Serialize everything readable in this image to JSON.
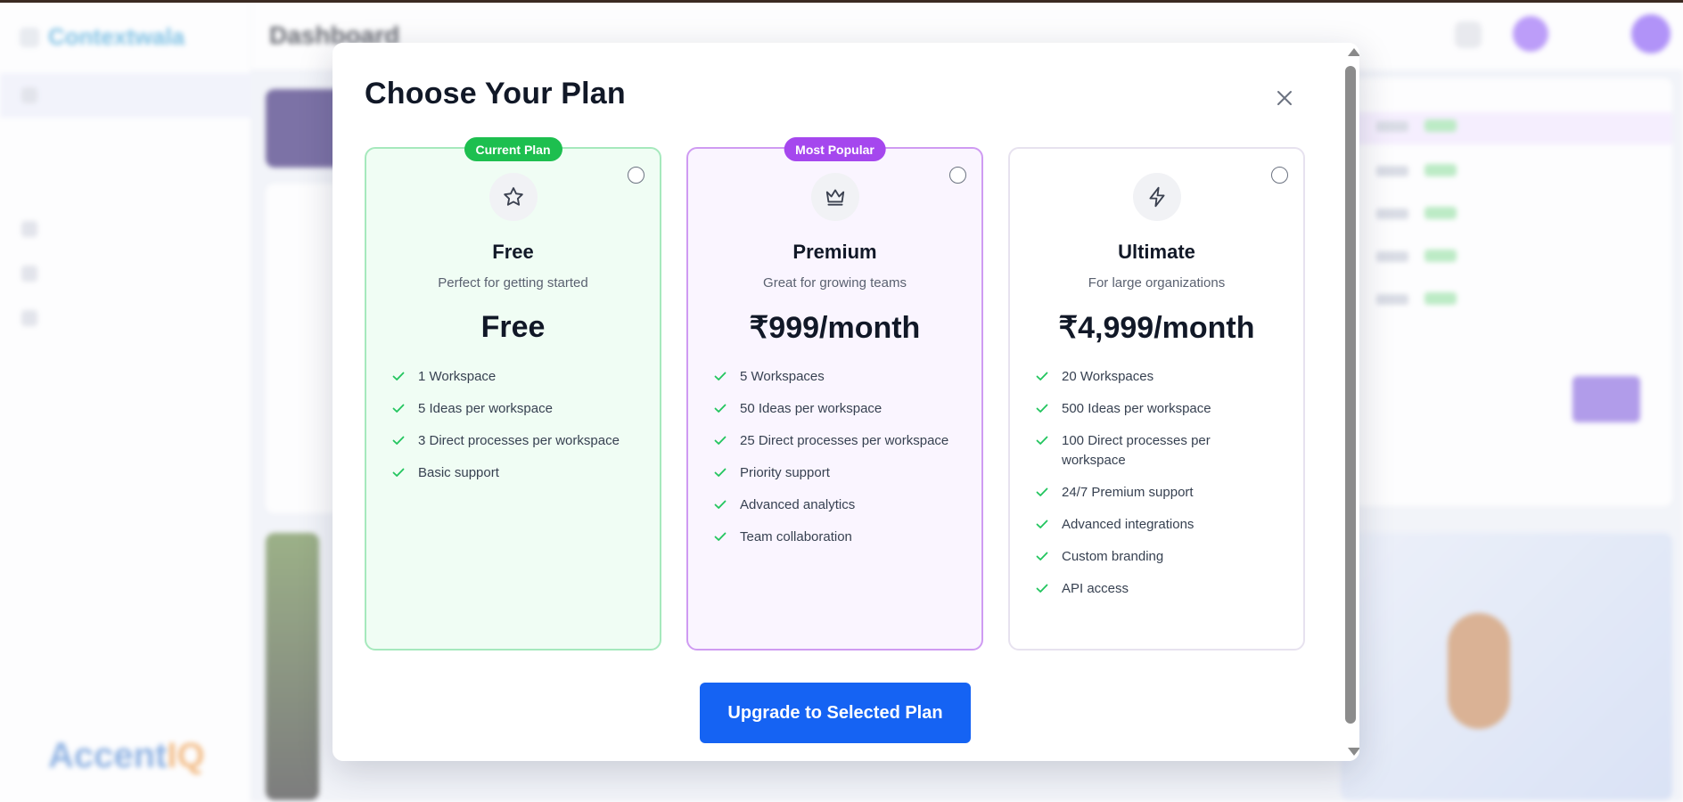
{
  "background": {
    "brand": "Contextwala",
    "page_title": "Dashboard",
    "footer_brand_a": "Accent",
    "footer_brand_b": "IQ"
  },
  "modal": {
    "title": "Choose Your Plan",
    "close_icon": "close-icon",
    "upgrade_label": "Upgrade to Selected Plan"
  },
  "plans": [
    {
      "id": "free",
      "badge": "Current Plan",
      "badge_color": "#1dbf4f",
      "icon": "star-icon",
      "name": "Free",
      "description": "Perfect for getting started",
      "price": "Free",
      "selected": false,
      "features": [
        "1 Workspace",
        "5 Ideas per workspace",
        "3 Direct processes per workspace",
        "Basic support"
      ]
    },
    {
      "id": "premium",
      "badge": "Most Popular",
      "badge_color": "#a547ee",
      "icon": "crown-icon",
      "name": "Premium",
      "description": "Great for growing teams",
      "price": "₹999/month",
      "selected": false,
      "features": [
        "5 Workspaces",
        "50 Ideas per workspace",
        "25 Direct processes per workspace",
        "Priority support",
        "Advanced analytics",
        "Team collaboration"
      ]
    },
    {
      "id": "ultimate",
      "badge": "",
      "icon": "lightning-icon",
      "name": "Ultimate",
      "description": "For large organizations",
      "price": "₹4,999/month",
      "selected": false,
      "features": [
        "20 Workspaces",
        "500 Ideas per workspace",
        "100 Direct processes per workspace",
        "24/7 Premium support",
        "Advanced integrations",
        "Custom branding",
        "API access"
      ]
    }
  ],
  "colors": {
    "check": "#22c55e",
    "primary_button": "#1563f3",
    "free_border": "#a6e9bd",
    "premium_border": "#cf9bf2"
  }
}
